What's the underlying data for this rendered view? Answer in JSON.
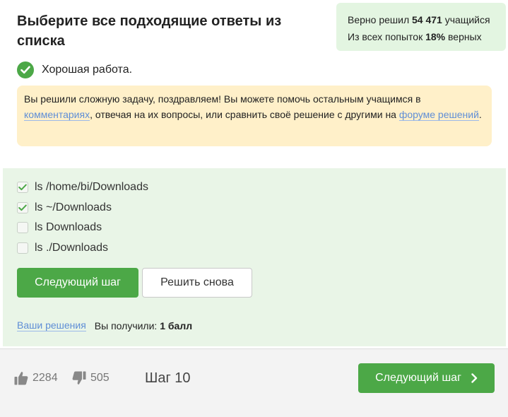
{
  "header": {
    "title": "Выберите все подходящие ответы из списка"
  },
  "stats": {
    "line1_prefix": "Верно решил",
    "solved_count": "54 471",
    "line1_suffix": "учащийся",
    "line2_prefix": "Из всех попыток",
    "percent": "18%",
    "line2_suffix": "верных"
  },
  "result": {
    "message": "Хорошая работа."
  },
  "notice": {
    "text1": "Вы решили сложную задачу, поздравляем! Вы можете помочь остальным учащимся в ",
    "link1": "комментариях",
    "text2": ", отвечая на их вопросы, или сравнить своё решение с другими на ",
    "link2": "форуме решений",
    "text3": "."
  },
  "options": [
    {
      "label": "ls /home/bi/Downloads",
      "checked": true
    },
    {
      "label": "ls ~/Downloads",
      "checked": true
    },
    {
      "label": "ls Downloads",
      "checked": false
    },
    {
      "label": "ls ./Downloads",
      "checked": false
    }
  ],
  "buttons": {
    "next_step": "Следующий шаг",
    "retry": "Решить снова"
  },
  "solutions": {
    "link": "Ваши решения",
    "score_prefix": "Вы получили:",
    "score": "1 балл"
  },
  "footer": {
    "likes": "2284",
    "dislikes": "505",
    "step": "Шаг 10",
    "next_step": "Следующий шаг"
  },
  "colors": {
    "accent_green": "#4ca847",
    "stats_bg": "#e3f5e1",
    "notice_bg": "#fff0c9",
    "answers_bg": "#e9f5e7",
    "link": "#5f8ed6"
  },
  "icons": {
    "result": "check-circle-icon",
    "option_checked": "checkmark-icon",
    "like": "thumbs-up-icon",
    "dislike": "thumbs-down-icon",
    "next": "chevron-right-icon"
  }
}
